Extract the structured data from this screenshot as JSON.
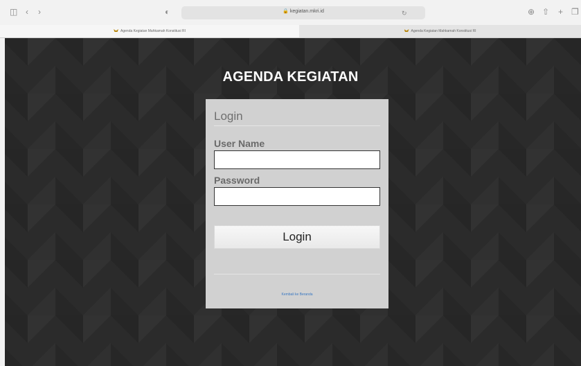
{
  "browser": {
    "url": "kegiatan.mkri.id",
    "icons": {
      "sidebar": "sidebar-icon",
      "back": "chevron-left-icon",
      "forward": "chevron-right-icon",
      "privacy": "shield-icon",
      "reload": "reload-icon",
      "download": "download-icon",
      "share": "share-icon",
      "new_tab": "plus-icon",
      "tabs": "tabs-overview-icon"
    },
    "tabs": [
      {
        "title": "Agenda Kegiatan Mahkamah Konstitusi RI",
        "active": true
      },
      {
        "title": "Agenda Kegiatan Mahkamah Konstitusi RI",
        "active": false
      }
    ]
  },
  "page": {
    "heading": "AGENDA KEGIATAN",
    "form": {
      "title": "Login",
      "username_label": "User Name",
      "username_value": "",
      "password_label": "Password",
      "password_value": "",
      "submit_label": "Login",
      "back_link": "Kembali ke Beranda"
    }
  },
  "colors": {
    "background": "#2b2b2b",
    "panel": "#d1d1d1",
    "link": "#3a78c2"
  }
}
